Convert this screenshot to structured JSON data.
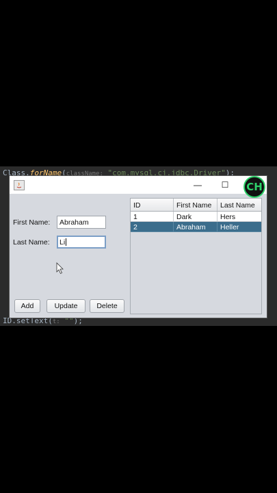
{
  "code": {
    "top_prefix": "Class.",
    "top_fn": "forName",
    "top_hint": "className:",
    "top_string": "\"com.mysql.cj.jdbc.Driver\"",
    "top_suffix": ");",
    "bottom_prefix": "ID.setText(",
    "bottom_hint": "t:",
    "bottom_string": "\"\"",
    "bottom_suffix": ");"
  },
  "window": {
    "logo_text": "CH",
    "minimize_glyph": "—",
    "maximize_glyph": "☐"
  },
  "form": {
    "first_name_label": "First Name:",
    "first_name_value": "Abraham",
    "last_name_label": "Last Name:",
    "last_name_value": "Li"
  },
  "buttons": {
    "add": "Add",
    "update": "Update",
    "delete": "Delete"
  },
  "table": {
    "columns": [
      "ID",
      "First Name",
      "Last Name"
    ],
    "rows": [
      {
        "id": "1",
        "first": "Dark",
        "last": "Hers"
      },
      {
        "id": "2",
        "first": "Abraham",
        "last": "Heller"
      }
    ],
    "selected_row": 2
  },
  "colors": {
    "selection": "#3b6d8c",
    "editor_bg": "#2b2b2b",
    "window_bg": "#d6d9df"
  }
}
